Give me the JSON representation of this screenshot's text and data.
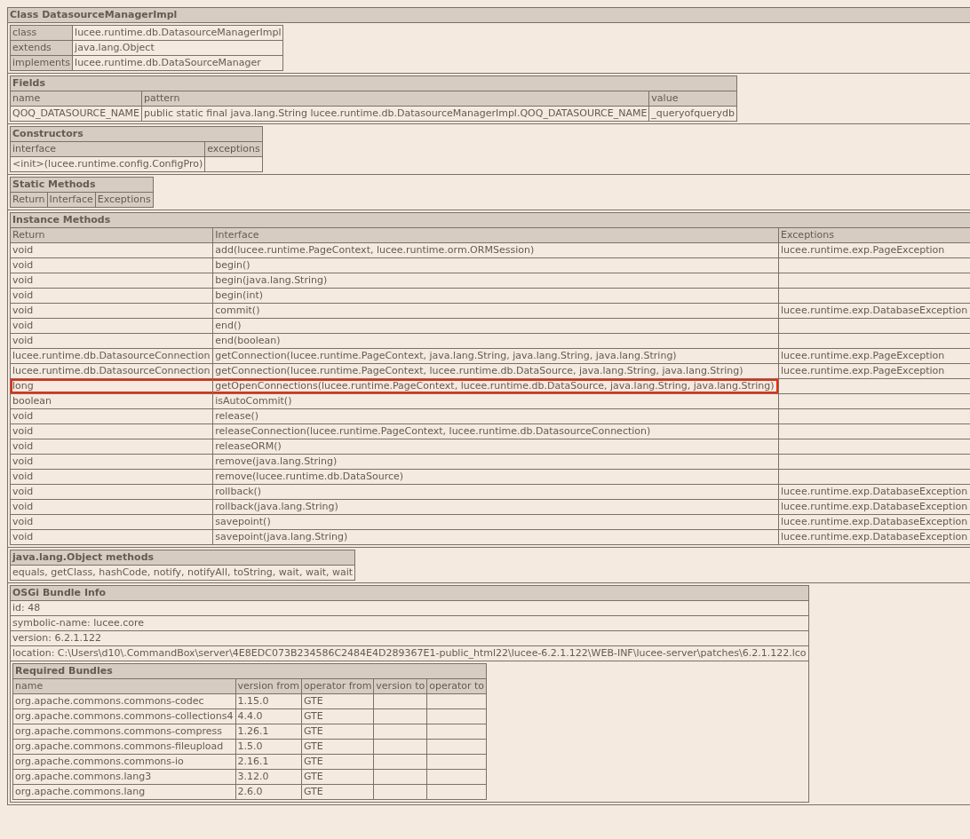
{
  "dump": {
    "title": "Class DatasourceManagerImpl",
    "info": [
      {
        "label": "class",
        "value": "lucee.runtime.db.DatasourceManagerImpl"
      },
      {
        "label": "extends",
        "value": "java.lang.Object"
      },
      {
        "label": "implements",
        "value": "lucee.runtime.db.DataSourceManager"
      }
    ],
    "fields": {
      "title": "Fields",
      "columns": [
        "name",
        "pattern",
        "value"
      ],
      "rows": [
        {
          "name": "QOQ_DATASOURCE_NAME",
          "pattern": "public static final java.lang.String lucee.runtime.db.DatasourceManagerImpl.QOQ_DATASOURCE_NAME",
          "value": "_queryofquerydb"
        }
      ]
    },
    "constructors": {
      "title": "Constructors",
      "columns": [
        "interface",
        "exceptions"
      ],
      "rows": [
        {
          "interface": "<init>(lucee.runtime.config.ConfigPro)"
        }
      ]
    },
    "static_methods": {
      "title": "Static Methods",
      "columns": [
        "Return",
        "Interface",
        "Exceptions"
      ]
    },
    "instance_methods": {
      "title": "Instance Methods",
      "columns": [
        "Return",
        "Interface",
        "Exceptions"
      ],
      "rows": [
        {
          "return": "void",
          "interface": "add(lucee.runtime.PageContext, lucee.runtime.orm.ORMSession)",
          "exceptions": "lucee.runtime.exp.PageException",
          "highlighted": false
        },
        {
          "return": "void",
          "interface": "begin()",
          "highlighted": false
        },
        {
          "return": "void",
          "interface": "begin(java.lang.String)",
          "highlighted": false
        },
        {
          "return": "void",
          "interface": "begin(int)",
          "highlighted": false
        },
        {
          "return": "void",
          "interface": "commit()",
          "exceptions": "lucee.runtime.exp.DatabaseException",
          "highlighted": false
        },
        {
          "return": "void",
          "interface": "end()",
          "highlighted": false
        },
        {
          "return": "void",
          "interface": "end(boolean)",
          "highlighted": false
        },
        {
          "return": "lucee.runtime.db.DatasourceConnection",
          "interface": "getConnection(lucee.runtime.PageContext, java.lang.String, java.lang.String, java.lang.String)",
          "exceptions": "lucee.runtime.exp.PageException",
          "highlighted": false
        },
        {
          "return": "lucee.runtime.db.DatasourceConnection",
          "interface": "getConnection(lucee.runtime.PageContext, lucee.runtime.db.DataSource, java.lang.String, java.lang.String)",
          "exceptions": "lucee.runtime.exp.PageException",
          "highlighted": false
        },
        {
          "return": "long",
          "interface": "getOpenConnections(lucee.runtime.PageContext, lucee.runtime.db.DataSource, java.lang.String, java.lang.String)",
          "highlighted": true
        },
        {
          "return": "boolean",
          "interface": "isAutoCommit()",
          "highlighted": false
        },
        {
          "return": "void",
          "interface": "release()",
          "highlighted": false
        },
        {
          "return": "void",
          "interface": "releaseConnection(lucee.runtime.PageContext, lucee.runtime.db.DatasourceConnection)",
          "highlighted": false
        },
        {
          "return": "void",
          "interface": "releaseORM()",
          "highlighted": false
        },
        {
          "return": "void",
          "interface": "remove(java.lang.String)",
          "highlighted": false
        },
        {
          "return": "void",
          "interface": "remove(lucee.runtime.db.DataSource)",
          "highlighted": false
        },
        {
          "return": "void",
          "interface": "rollback()",
          "exceptions": "lucee.runtime.exp.DatabaseException",
          "highlighted": false
        },
        {
          "return": "void",
          "interface": "rollback(java.lang.String)",
          "exceptions": "lucee.runtime.exp.DatabaseException",
          "highlighted": false
        },
        {
          "return": "void",
          "interface": "savepoint()",
          "exceptions": "lucee.runtime.exp.DatabaseException",
          "highlighted": false
        },
        {
          "return": "void",
          "interface": "savepoint(java.lang.String)",
          "exceptions": "lucee.runtime.exp.DatabaseException",
          "highlighted": false
        }
      ]
    },
    "object_methods": {
      "title": "java.lang.Object methods",
      "text": "equals, getClass, hashCode, notify, notifyAll, toString, wait, wait, wait"
    },
    "osgi": {
      "title": "OSGi Bundle Info",
      "lines": [
        "id: 48",
        "symbolic-name: lucee.core",
        "version: 6.2.1.122",
        "location: C:\\Users\\d10\\.CommandBox\\server\\4E8EDC073B234586C2484E4D289367E1-public_html22\\lucee-6.2.1.122\\WEB-INF\\lucee-server\\patches\\6.2.1.122.lco"
      ],
      "required_bundles": {
        "title": "Required Bundles",
        "columns": [
          "name",
          "version from",
          "operator from",
          "version to",
          "operator to"
        ],
        "rows": [
          {
            "name": "org.apache.commons.commons-codec",
            "version_from": "1.15.0",
            "operator_from": "GTE"
          },
          {
            "name": "org.apache.commons.commons-collections4",
            "version_from": "4.4.0",
            "operator_from": "GTE"
          },
          {
            "name": "org.apache.commons.commons-compress",
            "version_from": "1.26.1",
            "operator_from": "GTE"
          },
          {
            "name": "org.apache.commons.commons-fileupload",
            "version_from": "1.5.0",
            "operator_from": "GTE"
          },
          {
            "name": "org.apache.commons.commons-io",
            "version_from": "2.16.1",
            "operator_from": "GTE"
          },
          {
            "name": "org.apache.commons.lang3",
            "version_from": "3.12.0",
            "operator_from": "GTE"
          },
          {
            "name": "org.apache.commons.lang",
            "version_from": "2.6.0",
            "operator_from": "GTE"
          }
        ]
      }
    }
  }
}
